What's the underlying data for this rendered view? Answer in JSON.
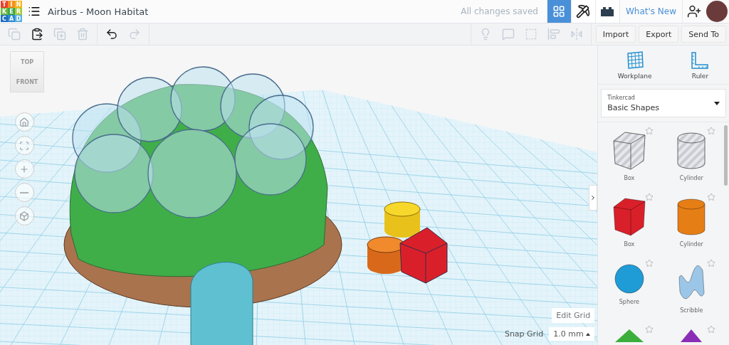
{
  "logo": {
    "letters": [
      "T",
      "I",
      "N",
      "K",
      "E",
      "R",
      "C",
      "A",
      "D"
    ]
  },
  "header": {
    "title": "Airbus - Moon Habitat",
    "save_status": "All changes saved",
    "view_buttons": [
      {
        "kind": "grid",
        "selected": true
      },
      {
        "kind": "pickaxe",
        "selected": false
      },
      {
        "kind": "bricks",
        "selected": false
      }
    ],
    "whats_new": "What's New"
  },
  "toolbar": {
    "edit_tools": [
      {
        "kind": "copy",
        "disabled": true
      },
      {
        "kind": "paste",
        "disabled": false
      },
      {
        "kind": "duplicate",
        "disabled": true
      },
      {
        "kind": "delete",
        "disabled": true
      },
      {
        "kind": "undo",
        "disabled": false
      },
      {
        "kind": "redo",
        "disabled": true
      }
    ],
    "shape_tools": [
      {
        "kind": "note",
        "disabled": true
      },
      {
        "kind": "group",
        "disabled": true
      },
      {
        "kind": "subtract",
        "disabled": true
      },
      {
        "kind": "align",
        "disabled": true
      },
      {
        "kind": "mirror",
        "disabled": true
      }
    ],
    "actions": [
      "Import",
      "Export",
      "Send To"
    ]
  },
  "view_cube": {
    "top": "TOP",
    "front": "FRONT"
  },
  "nav_controls": [
    {
      "kind": "home"
    },
    {
      "kind": "fit"
    },
    {
      "kind": "zoom_in"
    },
    {
      "kind": "zoom_out"
    },
    {
      "kind": "perspective"
    }
  ],
  "grid_controls": {
    "edit_grid": "Edit Grid",
    "snap_label": "Snap Grid",
    "snap_value": "1.0 mm"
  },
  "sidebar": {
    "tools": [
      {
        "kind": "workplane",
        "label": "Workplane"
      },
      {
        "kind": "ruler",
        "label": "Ruler"
      }
    ],
    "library": {
      "source": "Tinkercad",
      "category": "Basic Shapes"
    },
    "shapes": [
      {
        "kind": "box",
        "label": "Box",
        "hole": true
      },
      {
        "kind": "cylinder",
        "label": "Cylinder",
        "hole": true
      },
      {
        "kind": "box",
        "label": "Box",
        "hole": false,
        "color": "#d9202a"
      },
      {
        "kind": "cylinder",
        "label": "Cylinder",
        "hole": false,
        "color": "#e67e16"
      },
      {
        "kind": "sphere",
        "label": "Sphere",
        "hole": false,
        "color": "#1f9bd6"
      },
      {
        "kind": "scribble",
        "label": "Scribble",
        "hole": false,
        "color": "#9cc6e8"
      },
      {
        "kind": "pyramid",
        "hole": false,
        "color": "#3cae3c"
      },
      {
        "kind": "cone",
        "hole": false,
        "color": "#8a2fb5"
      }
    ]
  }
}
